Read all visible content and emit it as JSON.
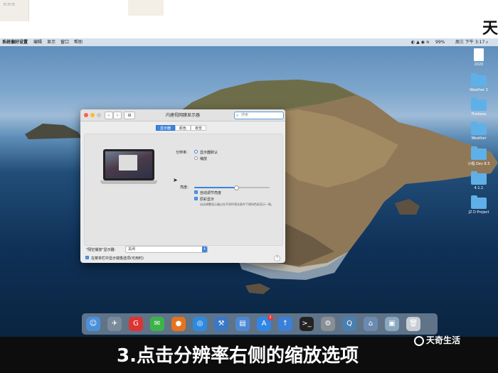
{
  "menubar": {
    "app": "系统偏好设置",
    "items": [
      "编辑",
      "显示",
      "窗口",
      "帮助"
    ],
    "battery": "99%",
    "clock": "周三 下午 3:17"
  },
  "desktop_icons": [
    {
      "label": "2020",
      "kind": "doc"
    },
    {
      "label": "Weather 2",
      "kind": "folder"
    },
    {
      "label": "Firebase",
      "kind": "folder"
    },
    {
      "label": "Weather",
      "kind": "folder"
    },
    {
      "label": "小程 Dev 8.5",
      "kind": "folder"
    },
    {
      "label": "4.1.1",
      "kind": "folder"
    },
    {
      "label": "JZ D Project",
      "kind": "folder"
    }
  ],
  "window": {
    "title": "内建视网膜显示器",
    "search_placeholder": "搜索",
    "nav_grid": "⊞",
    "tabs": [
      {
        "label": "显示器",
        "active": true
      },
      {
        "label": "颜色",
        "active": false
      },
      {
        "label": "夜览",
        "active": false
      }
    ],
    "resolution_label": "分辨率:",
    "resolution_options": [
      {
        "label": "显示器默认",
        "selected": true
      },
      {
        "label": "缩放",
        "selected": false
      }
    ],
    "brightness_label": "亮度:",
    "brightness_level": 0.55,
    "auto_brightness": "自动调节亮度",
    "truetone": "原彩显示",
    "truetone_desc": "自动调整显示器以在不同环境光条件下保持色彩显示一致。",
    "airplay_label": "\"隔空播放\"显示器:",
    "airplay_value": "关闭",
    "mirror_option": "在菜单栏中显示镜像选项(可用时)",
    "help": "?"
  },
  "dock": [
    {
      "name": "finder",
      "glyph": "☺",
      "color": "#4a90d9"
    },
    {
      "name": "launchpad",
      "glyph": "✈",
      "color": "#7a8a9a"
    },
    {
      "name": "app-g",
      "glyph": "G",
      "color": "#d33"
    },
    {
      "name": "wechat",
      "glyph": "✉",
      "color": "#3cb34a"
    },
    {
      "name": "firefox",
      "glyph": "●",
      "color": "#e8731d"
    },
    {
      "name": "safari",
      "glyph": "◎",
      "color": "#2d8ae0"
    },
    {
      "name": "xcode",
      "glyph": "⚒",
      "color": "#3a78c6"
    },
    {
      "name": "files",
      "glyph": "▤",
      "color": "#4c88d6"
    },
    {
      "name": "appstore",
      "glyph": "A",
      "color": "#2f86e6"
    },
    {
      "name": "upload",
      "glyph": "↑",
      "color": "#3a7fd8"
    },
    {
      "name": "terminal",
      "glyph": ">_",
      "color": "#222"
    },
    {
      "name": "system-prefs",
      "glyph": "⚙",
      "color": "#8a8f95"
    },
    {
      "name": "quicktime",
      "glyph": "Q",
      "color": "#4a7fb0"
    },
    {
      "name": "network",
      "glyph": "⌂",
      "color": "#6c8ab0"
    },
    {
      "name": "preview",
      "glyph": "▣",
      "color": "#8aa7c2"
    },
    {
      "name": "trash",
      "glyph": "🗑",
      "color": "#c8ced4"
    }
  ],
  "dock_badge": "2",
  "caption": "3.点击分辨率右侧的缩放选项",
  "watermark": "天奇生活",
  "top_brand": "天"
}
